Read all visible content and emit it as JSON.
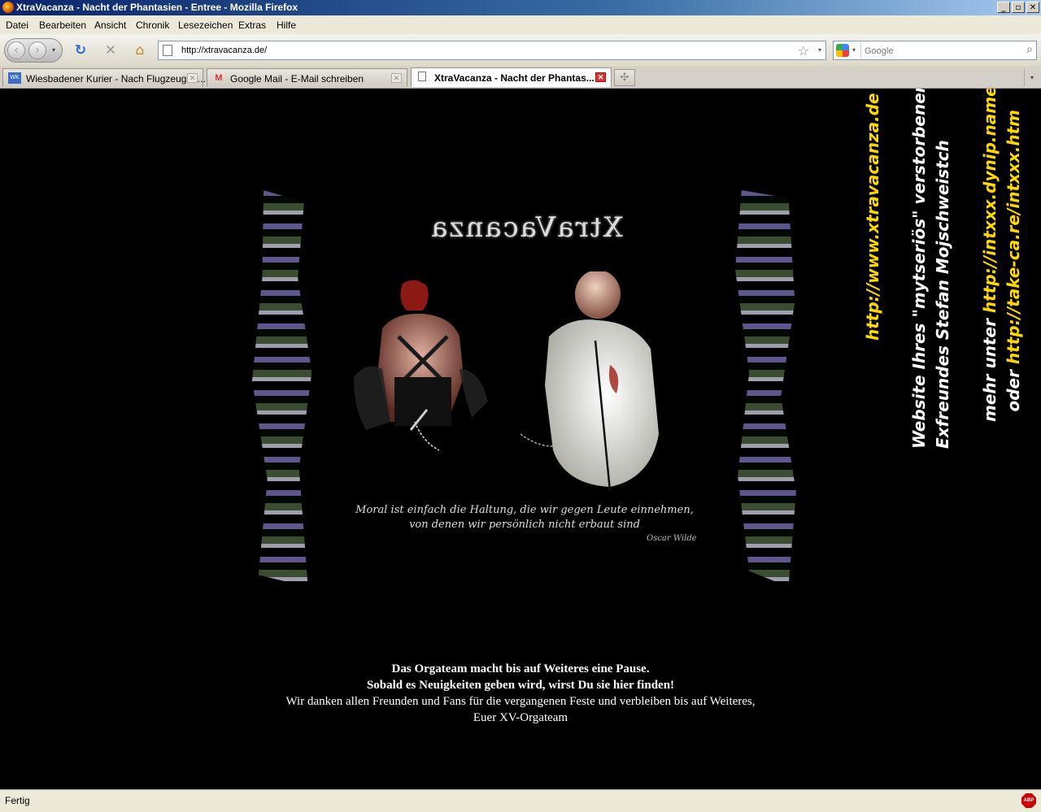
{
  "window": {
    "title": "XtraVacanza - Nacht der Phantasien - Entree - Mozilla Firefox",
    "buttons": [
      "_",
      "▫",
      "✕"
    ]
  },
  "menu": [
    "Datei",
    "Bearbeiten",
    "Ansicht",
    "Chronik",
    "Lesezeichen",
    "Extras",
    "Hilfe"
  ],
  "nav": {
    "url": "http://xtravacanza.de/",
    "search_placeholder": "Google"
  },
  "tabs": [
    {
      "label": "Wiesbadener Kurier - Nach Flugzeugab...",
      "icon": "news-icon"
    },
    {
      "label": "Google Mail - E-Mail schreiben",
      "icon": "gmail-icon"
    },
    {
      "label": "XtraVacanza - Nacht der Phantas...",
      "icon": "page-icon",
      "active": true
    }
  ],
  "content": {
    "logo": "XtraVacanza",
    "quote_line1": "Moral ist einfach die Haltung, die wir gegen Leute einnehmen,",
    "quote_line2": "von denen wir persönlich nicht erbaut sind",
    "quote_author": "Oscar Wilde",
    "msg_line1": "Das Orgateam macht bis auf Weiteres eine Pause.",
    "msg_line2": "Sobald es Neuigkeiten geben wird, wirst Du sie hier finden!",
    "msg_line3": "Wir danken allen Freunden und Fans für die vergangenen Feste und verbleiben bis auf Weiteres,",
    "msg_line4": "Euer XV-Orgateam"
  },
  "side": {
    "link1": "http://www.xtravacanza.de",
    "text2a": "Website Ihres \"mytseriös\" verstorbenen",
    "text2b": "Exfreundes Stefan Mojschweistch",
    "text3a_prefix": "mehr unter ",
    "text3a_link": "http://intxxx.dynip.name",
    "text3b_prefix": "oder ",
    "text3b_link": "http://take-ca.re/intxxx.htm"
  },
  "status": {
    "text": "Fertig",
    "addon": "ABP"
  },
  "colors": {
    "link_yellow": "#ffd800",
    "background": "#000000"
  }
}
